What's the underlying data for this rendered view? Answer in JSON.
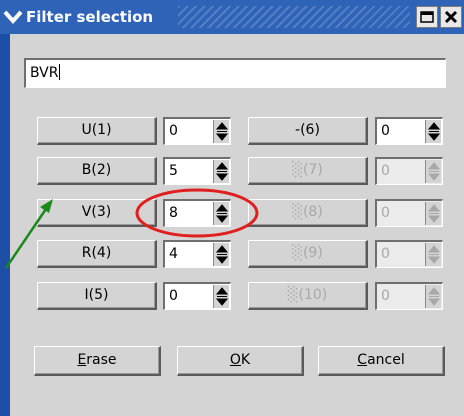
{
  "window": {
    "title": "Filter selection",
    "colors": {
      "titlebar": "#2e63b8",
      "frame": "#1e4fa6",
      "panel": "#d4d4d4",
      "highlight_ellipse": "#e02020",
      "annotation_arrow": "#1a8a1a"
    },
    "icons": {
      "menu": "chevron-down-icon",
      "maximize": "maximize-icon",
      "close": "close-icon",
      "spinner": "spin-arrows-icon"
    }
  },
  "name_field": {
    "value": "BVR"
  },
  "filters": [
    {
      "label": "U(1)",
      "value": "0",
      "enabled": true
    },
    {
      "label": "B(2)",
      "value": "5",
      "enabled": true
    },
    {
      "label": "V(3)",
      "value": "8",
      "enabled": true
    },
    {
      "label": "R(4)",
      "value": "4",
      "enabled": true
    },
    {
      "label": "I(5)",
      "value": "0",
      "enabled": true
    },
    {
      "label": "-(6)",
      "value": "0",
      "enabled": true
    },
    {
      "label": "░(7)",
      "value": "0",
      "enabled": false
    },
    {
      "label": "░(8)",
      "value": "0",
      "enabled": false
    },
    {
      "label": "░(9)",
      "value": "0",
      "enabled": false
    },
    {
      "label": "░(10)",
      "value": "0",
      "enabled": false
    }
  ],
  "buttons": {
    "erase": {
      "mnemonic": "E",
      "rest": "rase"
    },
    "ok": {
      "mnemonic": "O",
      "rest": "K"
    },
    "cancel": {
      "mnemonic": "C",
      "rest": "ancel"
    }
  }
}
